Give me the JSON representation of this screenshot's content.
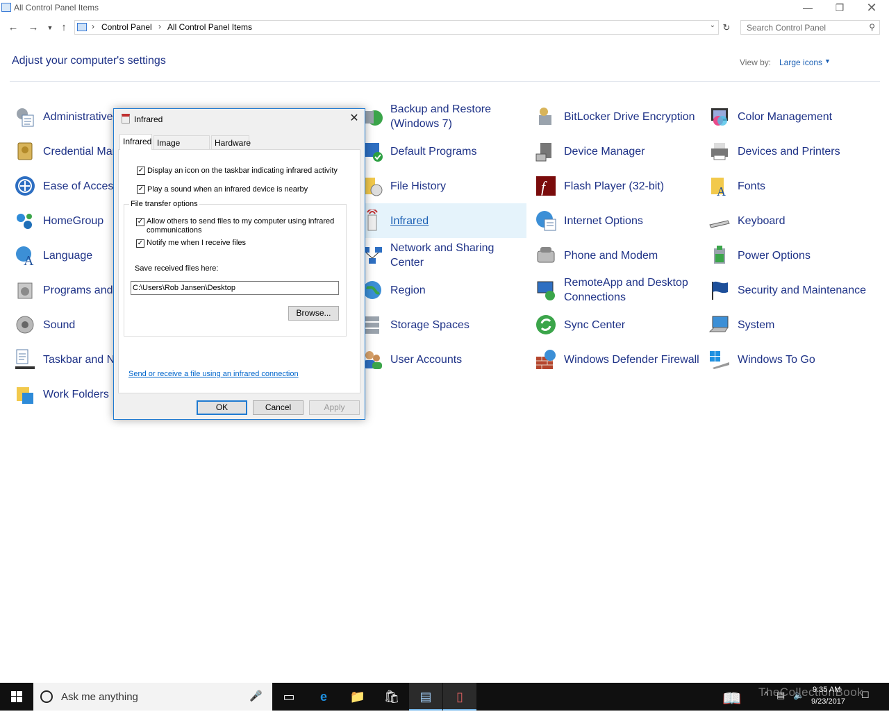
{
  "window": {
    "title": "All Control Panel Items",
    "controls": [
      "minimize",
      "restore",
      "close"
    ]
  },
  "address": {
    "breadcrumb": [
      "Control Panel",
      "All Control Panel Items"
    ],
    "search_placeholder": "Search Control Panel"
  },
  "header": {
    "title": "Adjust your computer's settings",
    "view_by_label": "View by:",
    "view_by_value": "Large icons"
  },
  "items": [
    {
      "label": "Administrative Tools",
      "icon": "admin-tools-icon"
    },
    {
      "label": "Credential Manager",
      "icon": "credential-manager-icon"
    },
    {
      "label": "Ease of Access Center",
      "icon": "ease-of-access-icon"
    },
    {
      "label": "HomeGroup",
      "icon": "homegroup-icon"
    },
    {
      "label": "Language",
      "icon": "language-icon"
    },
    {
      "label": "Programs and Features",
      "icon": "programs-icon"
    },
    {
      "label": "Sound",
      "icon": "sound-icon"
    },
    {
      "label": "Taskbar and Navigation",
      "icon": "taskbar-icon"
    },
    {
      "label": "Work Folders",
      "icon": "work-folders-icon"
    },
    {
      "label": "Backup and Restore (Windows 7)",
      "icon": "backup-icon"
    },
    {
      "label": "Default Programs",
      "icon": "default-programs-icon"
    },
    {
      "label": "File History",
      "icon": "file-history-icon"
    },
    {
      "label": "Infrared",
      "icon": "infrared-icon"
    },
    {
      "label": "Network and Sharing Center",
      "icon": "network-icon"
    },
    {
      "label": "Region",
      "icon": "region-icon"
    },
    {
      "label": "Storage Spaces",
      "icon": "storage-spaces-icon"
    },
    {
      "label": "User Accounts",
      "icon": "user-accounts-icon"
    },
    {
      "label": "BitLocker Drive Encryption",
      "icon": "bitlocker-icon"
    },
    {
      "label": "Device Manager",
      "icon": "device-manager-icon"
    },
    {
      "label": "Flash Player (32-bit)",
      "icon": "flash-icon"
    },
    {
      "label": "Internet Options",
      "icon": "internet-options-icon"
    },
    {
      "label": "Phone and Modem",
      "icon": "phone-modem-icon"
    },
    {
      "label": "RemoteApp and Desktop Connections",
      "icon": "remoteapp-icon"
    },
    {
      "label": "Sync Center",
      "icon": "sync-center-icon"
    },
    {
      "label": "Windows Defender Firewall",
      "icon": "firewall-icon"
    },
    {
      "label": "Color Management",
      "icon": "color-management-icon"
    },
    {
      "label": "Devices and Printers",
      "icon": "printer-icon"
    },
    {
      "label": "Fonts",
      "icon": "fonts-icon"
    },
    {
      "label": "Keyboard",
      "icon": "keyboard-icon"
    },
    {
      "label": "Power Options",
      "icon": "power-icon"
    },
    {
      "label": "Security and Maintenance",
      "icon": "security-flag-icon"
    },
    {
      "label": "System",
      "icon": "system-icon"
    },
    {
      "label": "Windows To Go",
      "icon": "windows-to-go-icon"
    }
  ],
  "dialog": {
    "title": "Infrared",
    "tabs": [
      "Infrared",
      "Image Transfer",
      "Hardware"
    ],
    "checkboxes": [
      {
        "label": "Display an icon on the taskbar indicating infrared activity",
        "checked": true
      },
      {
        "label": "Play a sound when an infrared device is nearby",
        "checked": true
      }
    ],
    "group_label": "File transfer options",
    "group_checkboxes": [
      {
        "label": "Allow others to send files to my computer using infrared communications",
        "checked": true
      },
      {
        "label": "Notify me when I receive files",
        "checked": true
      }
    ],
    "save_label": "Save received files here:",
    "save_path": "C:\\Users\\Rob Jansen\\Desktop",
    "browse": "Browse...",
    "link": "Send or receive a file using an infrared connection",
    "ok": "OK",
    "cancel": "Cancel",
    "apply": "Apply"
  },
  "taskbar": {
    "search_text": "Ask me anything",
    "watermark": "TheCollectionBook",
    "time": "9:35 AM",
    "date": "9/23/2017"
  }
}
